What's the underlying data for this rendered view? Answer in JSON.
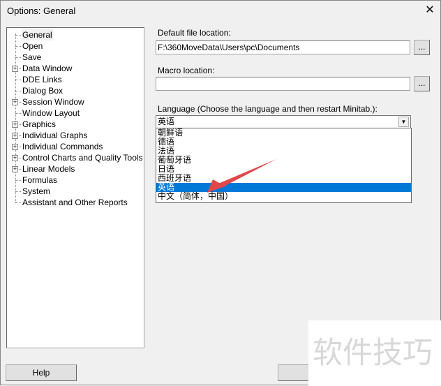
{
  "window": {
    "title": "Options: General",
    "close_icon": "close-icon"
  },
  "tree": {
    "items": [
      {
        "label": "General",
        "expandable": false,
        "selected": true
      },
      {
        "label": "Open",
        "expandable": false
      },
      {
        "label": "Save",
        "expandable": false
      },
      {
        "label": "Data Window",
        "expandable": true
      },
      {
        "label": "DDE Links",
        "expandable": false
      },
      {
        "label": "Dialog Box",
        "expandable": false
      },
      {
        "label": "Session Window",
        "expandable": true
      },
      {
        "label": "Window Layout",
        "expandable": false
      },
      {
        "label": "Graphics",
        "expandable": true
      },
      {
        "label": "Individual Graphs",
        "expandable": true
      },
      {
        "label": "Individual Commands",
        "expandable": true
      },
      {
        "label": "Control Charts and Quality Tools",
        "expandable": true
      },
      {
        "label": "Linear Models",
        "expandable": true
      },
      {
        "label": "Formulas",
        "expandable": false
      },
      {
        "label": "System",
        "expandable": false
      },
      {
        "label": "Assistant and Other Reports",
        "expandable": false
      }
    ]
  },
  "general": {
    "default_file_label": "Default file location:",
    "default_file_value": "F:\\360MoveData\\Users\\pc\\Documents",
    "browse_label": "...",
    "macro_label": "Macro location:",
    "macro_value": "",
    "language_label": "Language (Choose the language and then restart Minitab.):",
    "language_selected": "英语",
    "language_options": [
      "朝鲜语",
      "德语",
      "法语",
      "葡萄牙语",
      "日语",
      "西班牙语",
      "英语",
      "中文（简体，中国）"
    ],
    "highlighted_option": "英语"
  },
  "footer": {
    "help_label": "Help",
    "second_button_label": ""
  },
  "watermark": "软件技巧",
  "colors": {
    "selection": "#0078d7",
    "arrow": "#e0484a"
  }
}
